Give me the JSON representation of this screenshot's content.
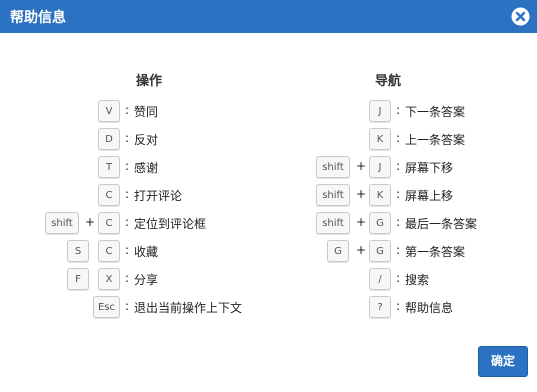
{
  "dialog": {
    "title": "帮助信息",
    "ok_label": "确定",
    "accent_color": "#2b73c2"
  },
  "left": {
    "title": "操作",
    "rows": [
      {
        "keys": [
          "V"
        ],
        "desc": "赞同"
      },
      {
        "keys": [
          "D"
        ],
        "desc": "反对"
      },
      {
        "keys": [
          "T"
        ],
        "desc": "感谢"
      },
      {
        "keys": [
          "C"
        ],
        "desc": "打开评论"
      },
      {
        "keys": [
          "shift",
          "C"
        ],
        "desc": "定位到评论框"
      },
      {
        "keys": [
          "S",
          "C"
        ],
        "desc": "收藏"
      },
      {
        "keys": [
          "F",
          "X"
        ],
        "desc": "分享"
      },
      {
        "keys": [
          "Esc"
        ],
        "desc": "退出当前操作上下文"
      }
    ]
  },
  "right": {
    "title": "导航",
    "rows": [
      {
        "keys": [
          "J"
        ],
        "desc": "下一条答案"
      },
      {
        "keys": [
          "K"
        ],
        "desc": "上一条答案"
      },
      {
        "keys": [
          "shift",
          "J"
        ],
        "desc": "屏幕下移"
      },
      {
        "keys": [
          "shift",
          "K"
        ],
        "desc": "屏幕上移"
      },
      {
        "keys": [
          "shift",
          "G"
        ],
        "desc": "最后一条答案"
      },
      {
        "keys": [
          "G",
          "G"
        ],
        "desc": "第一条答案"
      },
      {
        "keys": [
          "/"
        ],
        "desc": "搜索"
      },
      {
        "keys": [
          "?"
        ],
        "desc": "帮助信息"
      }
    ]
  },
  "symbols": {
    "plus": "+",
    "separator": ":"
  }
}
